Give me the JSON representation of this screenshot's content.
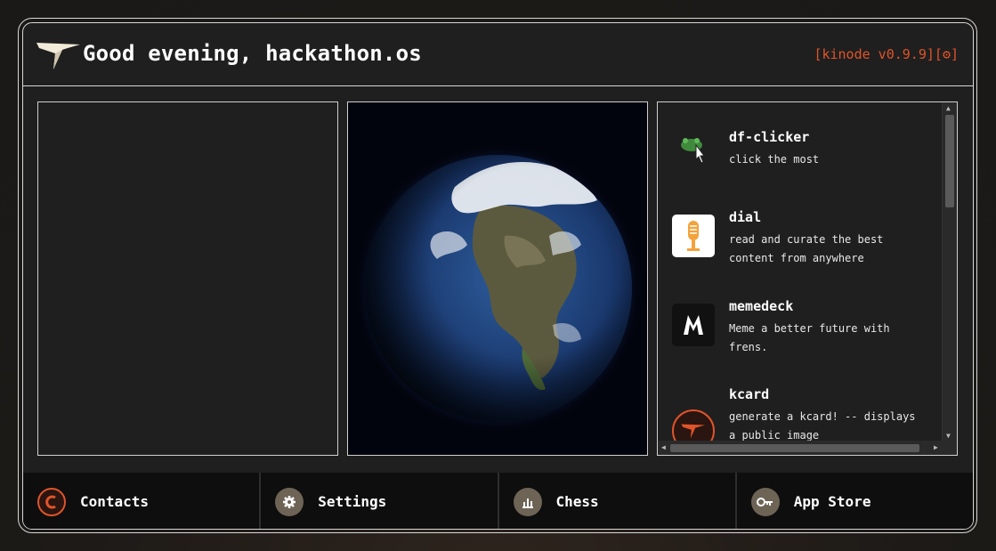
{
  "header": {
    "greeting": "Good evening, hackathon.os",
    "version": "[kinode v0.9.9][",
    "version_close": "]",
    "settings_glyph": "⚙"
  },
  "apps": [
    {
      "name": "df-clicker",
      "description": "click the most",
      "icon": "frog-cursor-icon"
    },
    {
      "name": "dial",
      "description": "read and curate the best content from anywhere",
      "icon": "microphone-icon"
    },
    {
      "name": "memedeck",
      "description": "Meme a better future with frens.",
      "icon": "memedeck-m-icon"
    },
    {
      "name": "kcard",
      "description": "generate a kcard! -- displays a public image",
      "icon": "kinode-logo-icon"
    }
  ],
  "dock": [
    {
      "label": "Contacts",
      "icon": "contacts-c-icon"
    },
    {
      "label": "Settings",
      "icon": "gear-icon"
    },
    {
      "label": "Chess",
      "icon": "chess-icon"
    },
    {
      "label": "App Store",
      "icon": "key-icon"
    }
  ],
  "colors": {
    "accent": "#e0542a",
    "frame": "#1f1f1f",
    "border": "#d8d8d8"
  }
}
